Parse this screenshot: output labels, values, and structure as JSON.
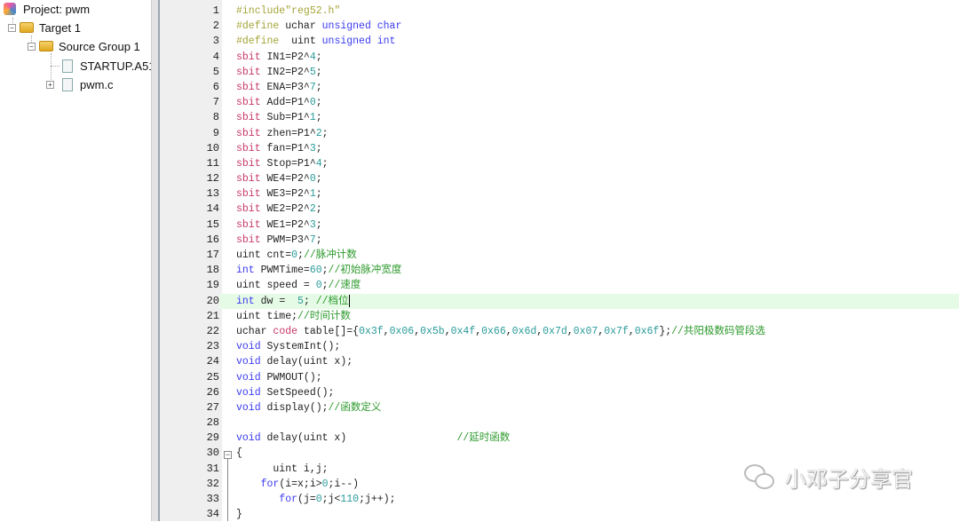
{
  "tree": {
    "project": "Project: pwm",
    "target": "Target 1",
    "group": "Source Group 1",
    "files": [
      "STARTUP.A51",
      "pwm.c"
    ]
  },
  "editor": {
    "lines": [
      {
        "n": "1",
        "t": [
          [
            "p",
            "#include\"reg52.h\""
          ]
        ]
      },
      {
        "n": "2",
        "t": [
          [
            "p",
            "#define "
          ],
          [
            "t",
            "uchar "
          ],
          [
            "k",
            "unsigned char"
          ]
        ]
      },
      {
        "n": "3",
        "t": [
          [
            "p",
            "#define  "
          ],
          [
            "t",
            "uint "
          ],
          [
            "k",
            "unsigned int"
          ]
        ]
      },
      {
        "n": "4",
        "t": [
          [
            "s",
            "sbit "
          ],
          [
            "t",
            "IN1=P2^"
          ],
          [
            "n",
            "4"
          ],
          [
            "t",
            ";"
          ]
        ]
      },
      {
        "n": "5",
        "t": [
          [
            "s",
            "sbit "
          ],
          [
            "t",
            "IN2=P2^"
          ],
          [
            "n",
            "5"
          ],
          [
            "t",
            ";"
          ]
        ]
      },
      {
        "n": "6",
        "t": [
          [
            "s",
            "sbit "
          ],
          [
            "t",
            "ENA=P3^"
          ],
          [
            "n",
            "7"
          ],
          [
            "t",
            ";"
          ]
        ]
      },
      {
        "n": "7",
        "t": [
          [
            "s",
            "sbit "
          ],
          [
            "t",
            "Add=P1^"
          ],
          [
            "n",
            "0"
          ],
          [
            "t",
            ";"
          ]
        ]
      },
      {
        "n": "8",
        "t": [
          [
            "s",
            "sbit "
          ],
          [
            "t",
            "Sub=P1^"
          ],
          [
            "n",
            "1"
          ],
          [
            "t",
            ";"
          ]
        ]
      },
      {
        "n": "9",
        "t": [
          [
            "s",
            "sbit "
          ],
          [
            "t",
            "zhen=P1^"
          ],
          [
            "n",
            "2"
          ],
          [
            "t",
            ";"
          ]
        ]
      },
      {
        "n": "10",
        "t": [
          [
            "s",
            "sbit "
          ],
          [
            "t",
            "fan=P1^"
          ],
          [
            "n",
            "3"
          ],
          [
            "t",
            ";"
          ]
        ]
      },
      {
        "n": "11",
        "t": [
          [
            "s",
            "sbit "
          ],
          [
            "t",
            "Stop=P1^"
          ],
          [
            "n",
            "4"
          ],
          [
            "t",
            ";"
          ]
        ]
      },
      {
        "n": "12",
        "t": [
          [
            "s",
            "sbit "
          ],
          [
            "t",
            "WE4=P2^"
          ],
          [
            "n",
            "0"
          ],
          [
            "t",
            ";"
          ]
        ]
      },
      {
        "n": "13",
        "t": [
          [
            "s",
            "sbit "
          ],
          [
            "t",
            "WE3=P2^"
          ],
          [
            "n",
            "1"
          ],
          [
            "t",
            ";"
          ]
        ]
      },
      {
        "n": "14",
        "t": [
          [
            "s",
            "sbit "
          ],
          [
            "t",
            "WE2=P2^"
          ],
          [
            "n",
            "2"
          ],
          [
            "t",
            ";"
          ]
        ]
      },
      {
        "n": "15",
        "t": [
          [
            "s",
            "sbit "
          ],
          [
            "t",
            "WE1=P2^"
          ],
          [
            "n",
            "3"
          ],
          [
            "t",
            ";"
          ]
        ]
      },
      {
        "n": "16",
        "t": [
          [
            "s",
            "sbit "
          ],
          [
            "t",
            "PWM=P3^"
          ],
          [
            "n",
            "7"
          ],
          [
            "t",
            ";"
          ]
        ]
      },
      {
        "n": "17",
        "t": [
          [
            "t",
            "uint cnt="
          ],
          [
            "n",
            "0"
          ],
          [
            "t",
            ";"
          ],
          [
            "c",
            "//脉冲计数"
          ]
        ]
      },
      {
        "n": "18",
        "t": [
          [
            "k",
            "int "
          ],
          [
            "t",
            "PWMTime="
          ],
          [
            "n",
            "60"
          ],
          [
            "t",
            ";"
          ],
          [
            "c",
            "//初始脉冲宽度"
          ]
        ]
      },
      {
        "n": "19",
        "t": [
          [
            "t",
            "uint speed = "
          ],
          [
            "n",
            "0"
          ],
          [
            "t",
            ";"
          ],
          [
            "c",
            "//速度"
          ]
        ]
      },
      {
        "n": "20",
        "t": [
          [
            "k",
            "int "
          ],
          [
            "t",
            "dw =  "
          ],
          [
            "n",
            "5"
          ],
          [
            "t",
            "; "
          ],
          [
            "c",
            "//档位"
          ]
        ]
      },
      {
        "n": "21",
        "t": [
          [
            "t",
            "uint time;"
          ],
          [
            "c",
            "//时间计数"
          ]
        ]
      },
      {
        "n": "22",
        "t": [
          [
            "t",
            "uchar "
          ],
          [
            "s",
            "code "
          ],
          [
            "t",
            "table[]={"
          ],
          [
            "n",
            "0x3f"
          ],
          [
            "t",
            ","
          ],
          [
            "n",
            "0x06"
          ],
          [
            "t",
            ","
          ],
          [
            "n",
            "0x5b"
          ],
          [
            "t",
            ","
          ],
          [
            "n",
            "0x4f"
          ],
          [
            "t",
            ","
          ],
          [
            "n",
            "0x66"
          ],
          [
            "t",
            ","
          ],
          [
            "n",
            "0x6d"
          ],
          [
            "t",
            ","
          ],
          [
            "n",
            "0x7d"
          ],
          [
            "t",
            ","
          ],
          [
            "n",
            "0x07"
          ],
          [
            "t",
            ","
          ],
          [
            "n",
            "0x7f"
          ],
          [
            "t",
            ","
          ],
          [
            "n",
            "0x6f"
          ],
          [
            "t",
            "};"
          ],
          [
            "c",
            "//共阳极数码管段选"
          ]
        ]
      },
      {
        "n": "23",
        "t": [
          [
            "k",
            "void "
          ],
          [
            "t",
            "SystemInt();"
          ]
        ]
      },
      {
        "n": "24",
        "t": [
          [
            "k",
            "void "
          ],
          [
            "t",
            "delay(uint x);"
          ]
        ]
      },
      {
        "n": "25",
        "t": [
          [
            "k",
            "void "
          ],
          [
            "t",
            "PWMOUT();"
          ]
        ]
      },
      {
        "n": "26",
        "t": [
          [
            "k",
            "void "
          ],
          [
            "t",
            "SetSpeed();"
          ]
        ]
      },
      {
        "n": "27",
        "t": [
          [
            "k",
            "void "
          ],
          [
            "t",
            "display();"
          ],
          [
            "c",
            "//函数定义"
          ]
        ]
      },
      {
        "n": "28",
        "t": []
      },
      {
        "n": "29",
        "t": [
          [
            "k",
            "void "
          ],
          [
            "t",
            "delay(uint x)                  "
          ],
          [
            "c",
            "//延时函数"
          ]
        ]
      },
      {
        "n": "30",
        "t": [
          [
            "t",
            "{"
          ]
        ]
      },
      {
        "n": "31",
        "t": [
          [
            "t",
            "      uint i,j;"
          ]
        ]
      },
      {
        "n": "32",
        "t": [
          [
            "t",
            "    "
          ],
          [
            "k",
            "for"
          ],
          [
            "t",
            "(i=x;i>"
          ],
          [
            "n",
            "0"
          ],
          [
            "t",
            ";i--)"
          ]
        ]
      },
      {
        "n": "33",
        "t": [
          [
            "t",
            "       "
          ],
          [
            "k",
            "for"
          ],
          [
            "t",
            "(j="
          ],
          [
            "n",
            "0"
          ],
          [
            "t",
            ";j<"
          ],
          [
            "n",
            "110"
          ],
          [
            "t",
            ";j++);"
          ]
        ]
      },
      {
        "n": "34",
        "t": [
          [
            "t",
            "}"
          ]
        ]
      }
    ],
    "highlight_line": "20"
  },
  "watermark": "小邓子分享官"
}
